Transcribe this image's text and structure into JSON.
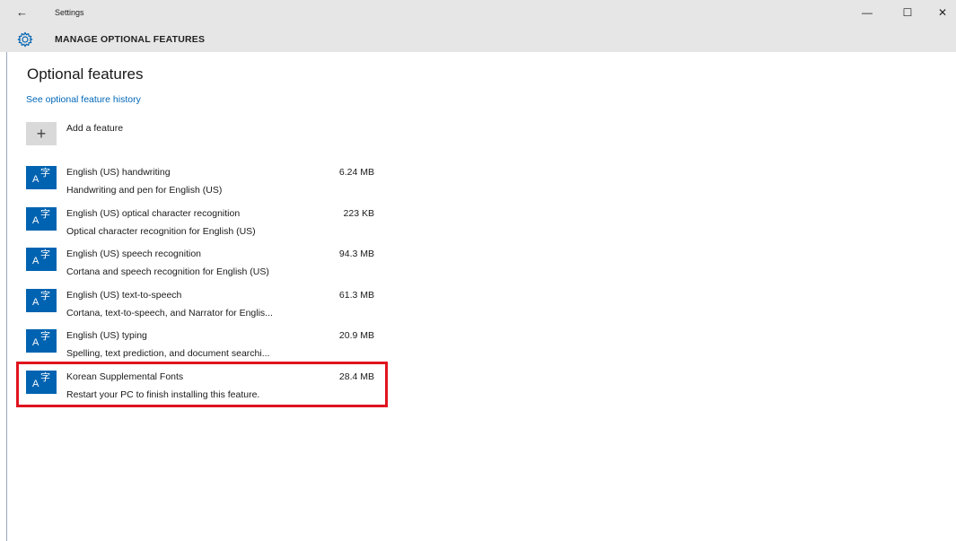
{
  "titlebar": {
    "title": "Settings",
    "back_icon": "←",
    "minimize_icon": "—",
    "maximize_icon": "☐",
    "close_icon": "✕"
  },
  "header": {
    "title": "MANAGE OPTIONAL FEATURES",
    "icon": "gear-icon"
  },
  "main": {
    "page_title": "Optional features",
    "history_link": "See optional feature history",
    "add_feature": {
      "icon": "+",
      "label": "Add a feature"
    },
    "features": [
      {
        "name": "English (US) handwriting",
        "size": "6.24 MB",
        "description": "Handwriting and pen for English (US)"
      },
      {
        "name": "English (US) optical character recognition",
        "size": "223 KB",
        "description": "Optical character recognition for English (US)"
      },
      {
        "name": "English (US) speech recognition",
        "size": "94.3 MB",
        "description": "Cortana and speech recognition for English (US)"
      },
      {
        "name": "English (US) text-to-speech",
        "size": "61.3 MB",
        "description": "Cortana, text-to-speech, and Narrator for Englis..."
      },
      {
        "name": "English (US) typing",
        "size": "20.9 MB",
        "description": "Spelling, text prediction, and document searchi..."
      },
      {
        "name": "Korean Supplemental Fonts",
        "size": "28.4 MB",
        "description": "Restart your PC to finish installing this feature.",
        "highlighted": true
      }
    ],
    "feature_icon": {
      "letter": "A",
      "glyph": "字",
      "color": "#0063b1"
    }
  },
  "colors": {
    "accent": "#0063b1",
    "link": "#0067b8",
    "highlight": "#e0141e",
    "chrome": "#e6e6e6"
  }
}
